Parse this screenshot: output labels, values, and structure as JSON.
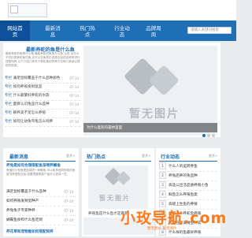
{
  "header": {
    "search_placeholder": "请输入关键词搜索"
  },
  "nav": [
    {
      "label": "网站首\n页",
      "active": true
    },
    {
      "label": "最新消\n息",
      "active": false
    },
    {
      "label": "热门热\n点",
      "active": false
    },
    {
      "label": "行业动\n态",
      "active": false
    },
    {
      "label": "品牌周\n周",
      "active": false
    }
  ],
  "headline": {
    "title": "最新养蛇的鱼是什么鱼",
    "desc": "最新养蛇的鱼是什么鱼,最新养蛇的鱼是什么鱼,当然,也可以不仅仅是养蛇鱼吃鱼,还可以在鱼类中选择合适的品种来进行搭配饲养,以下介绍几种关于养蛇鱼的饲养方法和几种适合搭配的鱼类。"
  },
  "top_list": [
    {
      "tag": "专栏",
      "title": "满足鼠标覆盖于什么品种颜色",
      "date": "07-14"
    },
    {
      "tag": "专栏",
      "title": "如何养殖发财鼠品",
      "date": "07-14"
    },
    {
      "tag": "专栏",
      "title": "什么最繁好养蛇的水族",
      "date": "07-14"
    },
    {
      "tag": "专栏",
      "title": "面目认识兔品什么品种",
      "date": "07-14"
    },
    {
      "tag": "专栏",
      "title": "解养美不宠怎么养殖",
      "date": "07-14"
    },
    {
      "tag": "专栏",
      "title": "如何让幼兔鸟龟怎么饲养",
      "date": "07-14"
    }
  ],
  "hero": {
    "placeholder": "暂无图片",
    "caption": "为什么喜欢的森林里面"
  },
  "latest": {
    "title": "最新消息",
    "more": "更多>",
    "lead_title": "养兔是如何合理搭配鱼苗喂养鲫鱼",
    "lead_desc": "养殖的小型鱼是选择同一种鲫鱼,可以和其他同种类的鱼苗饲养搭配合适,如果想要提高产量可以选择一些。",
    "items": [
      {
        "title": "满足鼠标覆盖于什么品种",
        "date": "07-14"
      },
      {
        "title": "如何养殖发财鼠种产",
        "date": "07-14"
      },
      {
        "title": "养兔兔子专家种养",
        "date": "07-14"
      },
      {
        "title": "蝴蝶鱼食和什么鱼吃饲",
        "date": "07-14"
      }
    ],
    "second_title": "养花草和宠物能如何搭配饲养"
  },
  "hot": {
    "title": "热门热点",
    "more": "更多>",
    "caption": "养殖鱼是什么鱼才是最新"
  },
  "industry": {
    "title": "行业动态",
    "more": "更多>",
    "items": [
      {
        "num": "1",
        "title": "什么人的运转养鱼",
        "date": "07-14"
      },
      {
        "num": "2",
        "title": "养兔后养的兔品种",
        "date": "07-14"
      },
      {
        "num": "3",
        "title": "高品公出活品质养殖小鱼",
        "date": "07-14"
      },
      {
        "num": "4",
        "title": "鲜鱼怎么养殖鱼类",
        "date": "07-14"
      },
      {
        "num": "5",
        "title": "高级上生鱼的养殖",
        "date": "07-14"
      },
      {
        "num": "6",
        "title": "如何上个养蛇鱼养殖",
        "date": "07-14"
      },
      {
        "num": "7",
        "title": "新手在了美做鱼种成",
        "date": "07-14"
      },
      {
        "num": "8",
        "title": "什么样的鱼最好养殖",
        "date": "07-14"
      }
    ]
  },
  "watermark": {
    "text": "小玫导航.com",
    "sub": "暂无图片    暂无图片"
  }
}
